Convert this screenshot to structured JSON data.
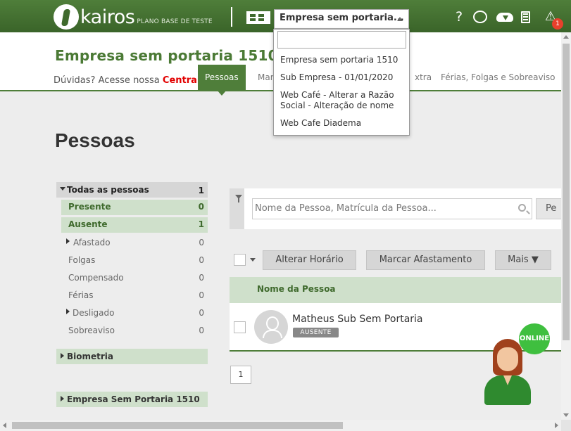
{
  "brand": {
    "name": "kairos",
    "tagline": "PLANO BASE DE TESTE"
  },
  "topbar": {
    "selected_company": "Empresa sem portaria...",
    "help_icon": "?",
    "warning_icon": "⚠",
    "notification_count": "1",
    "icons": [
      "help-icon",
      "chat-icon",
      "cloud-download-icon",
      "calculator-icon",
      "warning-icon"
    ]
  },
  "company_dropdown": {
    "search_value": "",
    "options": [
      "Empresa sem portaria 1510",
      "Sub Empresa - 01/01/2020",
      "Web Café - Alterar a Razão Social - Alteração de nome",
      "Web Cafe Diadema"
    ]
  },
  "header": {
    "company_title": "Empresa sem portaria 1510",
    "help_prefix": "Dúvidas? Acesse nossa ",
    "help_link": "Central de",
    "tabs": [
      {
        "label": "Pessoas",
        "active": true
      },
      {
        "label": "Marca",
        "active": false
      },
      {
        "label": "xtra",
        "active": false
      },
      {
        "label": "Férias, Folgas e Sobreaviso",
        "active": false
      }
    ]
  },
  "page": {
    "title": "Pessoas"
  },
  "filters": {
    "all": {
      "label": "Todas as pessoas",
      "count": "1"
    },
    "items": [
      {
        "label": "Presente",
        "count": "0"
      },
      {
        "label": "Ausente",
        "count": "1"
      },
      {
        "label": "Afastado",
        "count": "0"
      },
      {
        "label": "Folgas",
        "count": "0"
      },
      {
        "label": "Compensado",
        "count": "0"
      },
      {
        "label": "Férias",
        "count": "0"
      },
      {
        "label": "Desligado",
        "count": "0"
      },
      {
        "label": "Sobreaviso",
        "count": "0"
      }
    ],
    "sections": [
      "Biometria",
      "Empresa Sem Portaria 1510"
    ]
  },
  "search": {
    "placeholder": "Nome da Pessoa, Matrícula da Pessoa...",
    "button_label": "Pe"
  },
  "actions": {
    "change_schedule": "Alterar Horário",
    "mark_leave": "Marcar Afastamento",
    "more": "Mais ▼"
  },
  "table": {
    "column": "Nome da Pessoa",
    "rows": [
      {
        "name": "Matheus Sub Sem Portaria",
        "status": "AUSENTE"
      }
    ]
  },
  "pagination": {
    "current": "1"
  },
  "chat_widget": {
    "label": "ONLINE",
    "color": "#3fbf3f"
  },
  "colors": {
    "brand_green": "#4f7e3a",
    "light_green": "#cfe0cb",
    "link_red": "#e20000"
  }
}
